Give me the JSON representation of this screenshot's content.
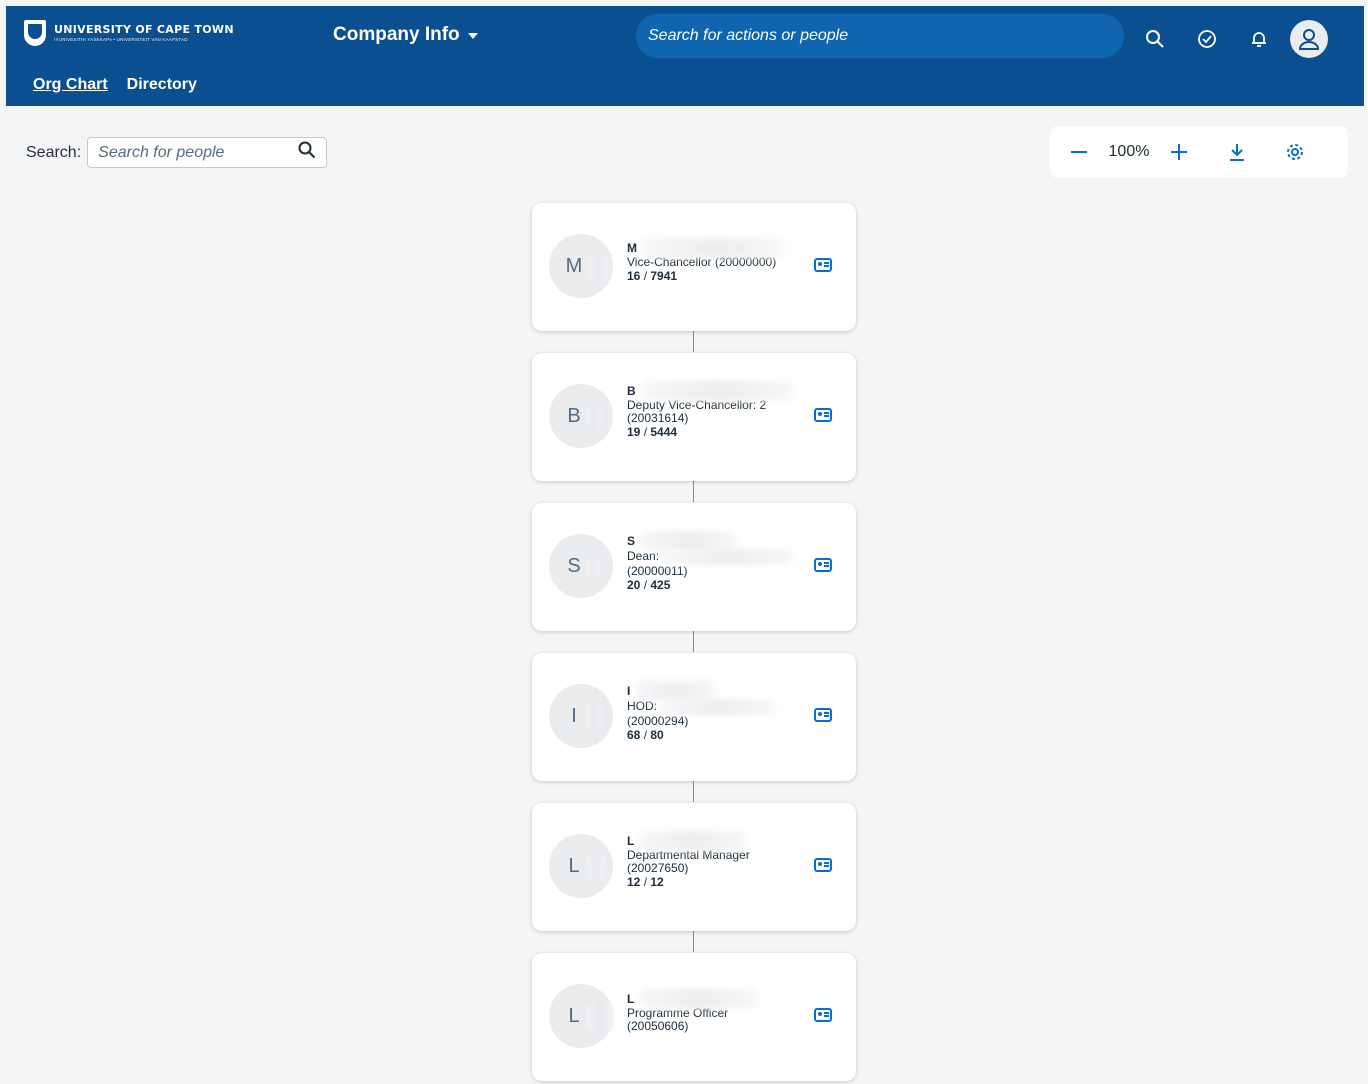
{
  "header": {
    "logo_main": "UNIVERSITY OF CAPE TOWN",
    "logo_sub": "IYUNIVESITHI YASEKAPA • UNIVERSITEIT VAN KAAPSTAD",
    "app_title": "Company Info",
    "search_placeholder": "Search for actions or people",
    "icons": [
      "search-icon",
      "check-circle-icon",
      "bell-icon",
      "user-avatar-icon"
    ]
  },
  "subnav": {
    "tabs": [
      {
        "label": "Org Chart",
        "active": true
      },
      {
        "label": "Directory",
        "active": false
      }
    ]
  },
  "people_search": {
    "label": "Search:",
    "placeholder": "Search for people"
  },
  "zoom": {
    "value": "100%",
    "icons": [
      "minus-icon",
      "plus-icon",
      "download-icon",
      "settings-icon"
    ]
  },
  "org_chart": {
    "nodes": [
      {
        "initial": "M",
        "name": "M",
        "title": "Vice-Chancellor (20000000)",
        "direct": "16",
        "total": "7941"
      },
      {
        "initial": "B",
        "name": "B",
        "title": "Deputy Vice-Chancellor: 2",
        "title2": "(20031614)",
        "direct": "19",
        "total": "5444"
      },
      {
        "initial": "S",
        "name": "S",
        "title": "Dean:",
        "title2": "(20000011)",
        "direct": "20",
        "total": "425"
      },
      {
        "initial": "I",
        "name": "I",
        "title": "HOD:",
        "title2": "(20000294)",
        "direct": "68",
        "total": "80"
      },
      {
        "initial": "L",
        "name": "L",
        "title": "Departmental Manager",
        "title2": "(20027650)",
        "direct": "12",
        "total": "12"
      },
      {
        "initial": "L",
        "name": "L",
        "title": "Programme Officer",
        "title2": "(20050606)"
      }
    ]
  }
}
